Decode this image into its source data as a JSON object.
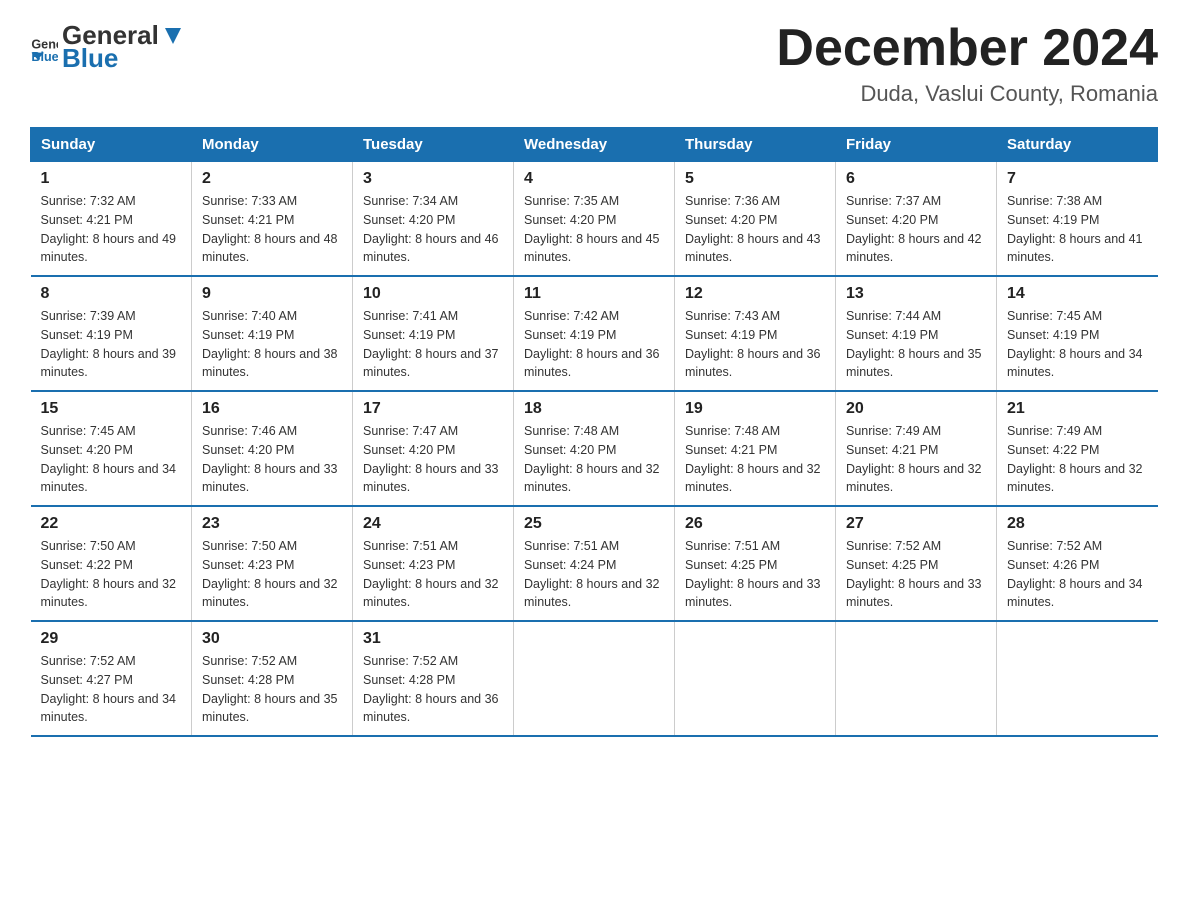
{
  "header": {
    "logo_general": "General",
    "logo_blue": "Blue",
    "month_year": "December 2024",
    "location": "Duda, Vaslui County, Romania"
  },
  "days_of_week": [
    "Sunday",
    "Monday",
    "Tuesday",
    "Wednesday",
    "Thursday",
    "Friday",
    "Saturday"
  ],
  "weeks": [
    [
      {
        "day": "1",
        "sunrise": "7:32 AM",
        "sunset": "4:21 PM",
        "daylight": "8 hours and 49 minutes."
      },
      {
        "day": "2",
        "sunrise": "7:33 AM",
        "sunset": "4:21 PM",
        "daylight": "8 hours and 48 minutes."
      },
      {
        "day": "3",
        "sunrise": "7:34 AM",
        "sunset": "4:20 PM",
        "daylight": "8 hours and 46 minutes."
      },
      {
        "day": "4",
        "sunrise": "7:35 AM",
        "sunset": "4:20 PM",
        "daylight": "8 hours and 45 minutes."
      },
      {
        "day": "5",
        "sunrise": "7:36 AM",
        "sunset": "4:20 PM",
        "daylight": "8 hours and 43 minutes."
      },
      {
        "day": "6",
        "sunrise": "7:37 AM",
        "sunset": "4:20 PM",
        "daylight": "8 hours and 42 minutes."
      },
      {
        "day": "7",
        "sunrise": "7:38 AM",
        "sunset": "4:19 PM",
        "daylight": "8 hours and 41 minutes."
      }
    ],
    [
      {
        "day": "8",
        "sunrise": "7:39 AM",
        "sunset": "4:19 PM",
        "daylight": "8 hours and 39 minutes."
      },
      {
        "day": "9",
        "sunrise": "7:40 AM",
        "sunset": "4:19 PM",
        "daylight": "8 hours and 38 minutes."
      },
      {
        "day": "10",
        "sunrise": "7:41 AM",
        "sunset": "4:19 PM",
        "daylight": "8 hours and 37 minutes."
      },
      {
        "day": "11",
        "sunrise": "7:42 AM",
        "sunset": "4:19 PM",
        "daylight": "8 hours and 36 minutes."
      },
      {
        "day": "12",
        "sunrise": "7:43 AM",
        "sunset": "4:19 PM",
        "daylight": "8 hours and 36 minutes."
      },
      {
        "day": "13",
        "sunrise": "7:44 AM",
        "sunset": "4:19 PM",
        "daylight": "8 hours and 35 minutes."
      },
      {
        "day": "14",
        "sunrise": "7:45 AM",
        "sunset": "4:19 PM",
        "daylight": "8 hours and 34 minutes."
      }
    ],
    [
      {
        "day": "15",
        "sunrise": "7:45 AM",
        "sunset": "4:20 PM",
        "daylight": "8 hours and 34 minutes."
      },
      {
        "day": "16",
        "sunrise": "7:46 AM",
        "sunset": "4:20 PM",
        "daylight": "8 hours and 33 minutes."
      },
      {
        "day": "17",
        "sunrise": "7:47 AM",
        "sunset": "4:20 PM",
        "daylight": "8 hours and 33 minutes."
      },
      {
        "day": "18",
        "sunrise": "7:48 AM",
        "sunset": "4:20 PM",
        "daylight": "8 hours and 32 minutes."
      },
      {
        "day": "19",
        "sunrise": "7:48 AM",
        "sunset": "4:21 PM",
        "daylight": "8 hours and 32 minutes."
      },
      {
        "day": "20",
        "sunrise": "7:49 AM",
        "sunset": "4:21 PM",
        "daylight": "8 hours and 32 minutes."
      },
      {
        "day": "21",
        "sunrise": "7:49 AM",
        "sunset": "4:22 PM",
        "daylight": "8 hours and 32 minutes."
      }
    ],
    [
      {
        "day": "22",
        "sunrise": "7:50 AM",
        "sunset": "4:22 PM",
        "daylight": "8 hours and 32 minutes."
      },
      {
        "day": "23",
        "sunrise": "7:50 AM",
        "sunset": "4:23 PM",
        "daylight": "8 hours and 32 minutes."
      },
      {
        "day": "24",
        "sunrise": "7:51 AM",
        "sunset": "4:23 PM",
        "daylight": "8 hours and 32 minutes."
      },
      {
        "day": "25",
        "sunrise": "7:51 AM",
        "sunset": "4:24 PM",
        "daylight": "8 hours and 32 minutes."
      },
      {
        "day": "26",
        "sunrise": "7:51 AM",
        "sunset": "4:25 PM",
        "daylight": "8 hours and 33 minutes."
      },
      {
        "day": "27",
        "sunrise": "7:52 AM",
        "sunset": "4:25 PM",
        "daylight": "8 hours and 33 minutes."
      },
      {
        "day": "28",
        "sunrise": "7:52 AM",
        "sunset": "4:26 PM",
        "daylight": "8 hours and 34 minutes."
      }
    ],
    [
      {
        "day": "29",
        "sunrise": "7:52 AM",
        "sunset": "4:27 PM",
        "daylight": "8 hours and 34 minutes."
      },
      {
        "day": "30",
        "sunrise": "7:52 AM",
        "sunset": "4:28 PM",
        "daylight": "8 hours and 35 minutes."
      },
      {
        "day": "31",
        "sunrise": "7:52 AM",
        "sunset": "4:28 PM",
        "daylight": "8 hours and 36 minutes."
      },
      null,
      null,
      null,
      null
    ]
  ]
}
